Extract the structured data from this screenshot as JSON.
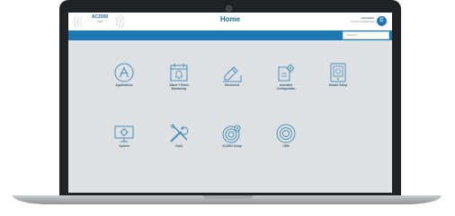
{
  "header": {
    "logo_text": "AC2000",
    "logo_sub": "CEM",
    "title": "Home",
    "user_name": "cemadmin",
    "user_status": "SN 6CE CONNECTED",
    "user_initial": "C"
  },
  "search": {
    "placeholder": "SEARCH"
  },
  "tiles": [
    {
      "label": "Applications",
      "icon": "applications-icon"
    },
    {
      "label": "Alarm + Event\nMonitoring",
      "icon": "alarm-bell-icon"
    },
    {
      "label": "Enrolment",
      "icon": "pencil-icon"
    },
    {
      "label": "ainerated\nConfiguration",
      "icon": "document-gear-icon"
    },
    {
      "label": "Reader Setup",
      "icon": "reader-gear-icon"
    },
    {
      "label": "System",
      "icon": "monitor-gear-icon"
    },
    {
      "label": "Tools",
      "icon": "wrench-screwdriver-icon"
    },
    {
      "label": "AC2000 Setup",
      "icon": "target-gear-icon"
    },
    {
      "label": "CEM",
      "icon": "cem-circle-icon"
    }
  ],
  "colors": {
    "accent": "#1d78b3",
    "icon": "#4a90b8",
    "background": "#dde1e4"
  }
}
